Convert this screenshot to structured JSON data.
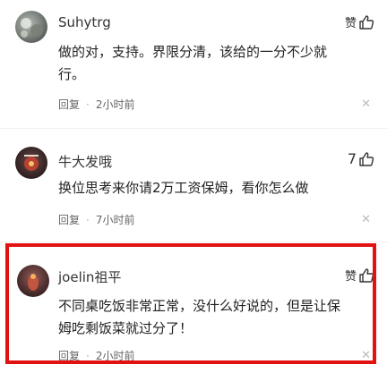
{
  "comments": [
    {
      "username": "Suhytrg",
      "like_label": "赞",
      "text_lines": [
        "做的对，支持。界限分清，该给的一分不少就",
        "行。"
      ],
      "reply": "回复",
      "time": "2小时前",
      "close": "✕"
    },
    {
      "username": "牛大发哦",
      "like_count": "7",
      "text_lines": [
        "换位思考来你请2万工资保姆，看你怎么做"
      ],
      "reply": "回复",
      "time": "7小时前",
      "close": "✕"
    },
    {
      "username": "joelin祖平",
      "like_label": "赞",
      "text_lines": [
        "不同桌吃饭非常正常，没什么好说的，但是让保",
        "姆吃剩饭菜就过分了！"
      ],
      "reply": "回复",
      "time": "2小时前",
      "close": "✕"
    }
  ],
  "colors": {
    "highlight": "#e31212"
  }
}
